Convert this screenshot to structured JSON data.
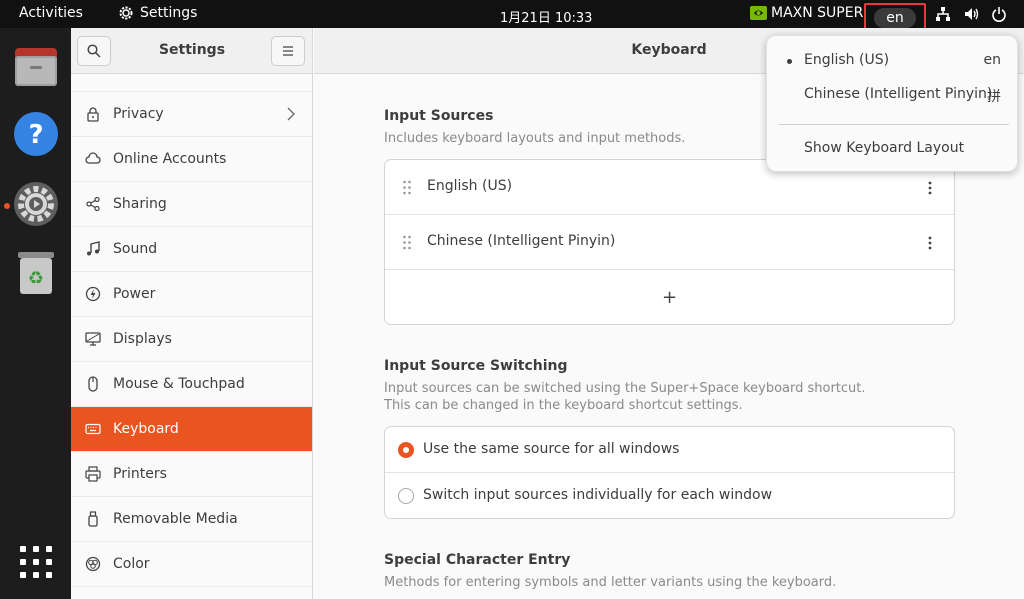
{
  "topbar": {
    "activities": "Activities",
    "app_name": "Settings",
    "clock": "1月21日  10:33",
    "nvidia_mode": "MAXN SUPER",
    "input_indicator": "en"
  },
  "sidebar": {
    "title": "Settings",
    "items": [
      {
        "label": "Privacy",
        "icon": "lock-icon"
      },
      {
        "label": "Online Accounts",
        "icon": "cloud-icon"
      },
      {
        "label": "Sharing",
        "icon": "share-icon"
      },
      {
        "label": "Sound",
        "icon": "music-note-icon"
      },
      {
        "label": "Power",
        "icon": "power-icon"
      },
      {
        "label": "Displays",
        "icon": "display-icon"
      },
      {
        "label": "Mouse & Touchpad",
        "icon": "mouse-icon"
      },
      {
        "label": "Keyboard",
        "icon": "keyboard-icon"
      },
      {
        "label": "Printers",
        "icon": "printer-icon"
      },
      {
        "label": "Removable Media",
        "icon": "usb-icon"
      },
      {
        "label": "Color",
        "icon": "color-icon"
      }
    ],
    "active_index": 7
  },
  "main": {
    "title": "Keyboard",
    "input_sources": {
      "title": "Input Sources",
      "subtitle": "Includes keyboard layouts and input methods.",
      "sources": [
        "English (US)",
        "Chinese (Intelligent Pinyin)"
      ],
      "add_label": "+"
    },
    "switching": {
      "title": "Input Source Switching",
      "subtitle_1": "Input sources can be switched using the Super+Space keyboard shortcut.",
      "subtitle_2": "This can be changed in the keyboard shortcut settings.",
      "options": [
        "Use the same source for all windows",
        "Switch input sources individually for each window"
      ],
      "selected_index": 0
    },
    "special": {
      "title": "Special Character Entry",
      "subtitle": "Methods for entering symbols and letter variants using the keyboard."
    }
  },
  "popup": {
    "items": [
      {
        "label": "English (US)",
        "right": "en",
        "selected": true
      },
      {
        "label": "Chinese (Intelligent Pinyin)",
        "right": "拼",
        "selected": false
      }
    ],
    "show_layout": "Show Keyboard Layout"
  },
  "colors": {
    "accent": "#e95420",
    "topbar": "#111111",
    "dock": "#1d1d1d",
    "highlight_box": "#e8383d"
  }
}
